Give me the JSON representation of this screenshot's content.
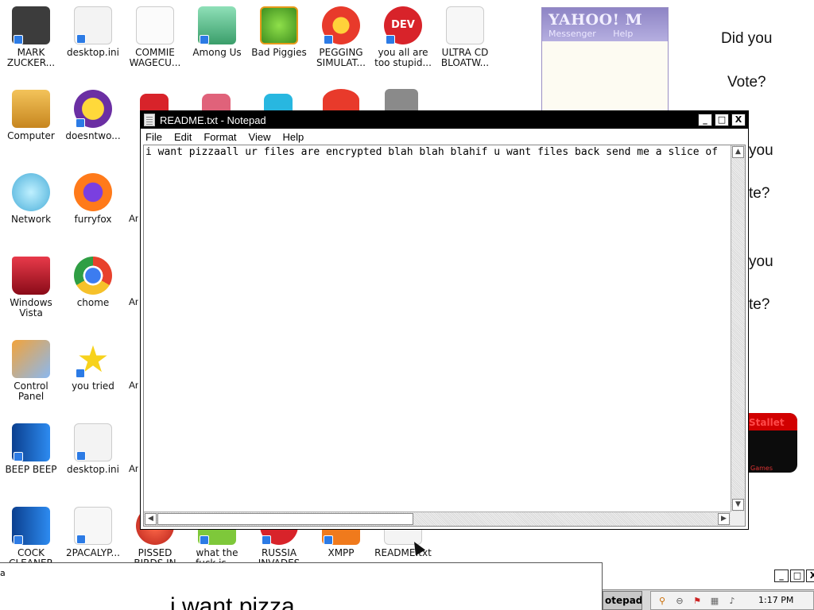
{
  "desktop": {
    "icons": [
      {
        "label": "MARK ZUCKER...",
        "icon": "mark-zuckerberg-icon",
        "color": "#4a4a4a"
      },
      {
        "label": "desktop.ini",
        "icon": "settings-file-icon",
        "color": "#f2f2f2"
      },
      {
        "label": "COMMIE WAGECU...",
        "icon": "document-icon",
        "color": "#fafafa"
      },
      {
        "label": "Among Us",
        "icon": "among-us-icon",
        "color": "#5fbf8a"
      },
      {
        "label": "Bad Piggies",
        "icon": "bad-piggies-icon",
        "color": "#7fcf3a"
      },
      {
        "label": "PEGGING SIMULAT...",
        "icon": "p-logo-icon",
        "color": "#e83a2b"
      },
      {
        "label": "you all are too stupid...",
        "icon": "dev-cpp-icon",
        "color": "#d8232a"
      },
      {
        "label": "ULTRA CD BLOATW...",
        "icon": "document-icon",
        "color": "#f7f7f7"
      },
      {
        "label": "Computer",
        "icon": "computer-icon",
        "color": "#d9a73a"
      },
      {
        "label": "doesntwo...",
        "icon": "yahoo-messenger-icon",
        "color": "#6b2fa3"
      },
      {
        "label": "Network",
        "icon": "network-globe-icon",
        "color": "#5bb7e0"
      },
      {
        "label": "furryfox",
        "icon": "firefox-icon",
        "color": "#ff7a1a"
      },
      {
        "label": "Windows Vista",
        "icon": "recycle-bin-icon",
        "color": "#c4152a"
      },
      {
        "label": "chome",
        "icon": "chrome-icon",
        "color": "#2f9e44"
      },
      {
        "label": "Control Panel",
        "icon": "control-panel-icon",
        "color": "#e08a3a"
      },
      {
        "label": "you tried",
        "icon": "star-icon",
        "color": "#f7d21c"
      },
      {
        "label": "BEEP BEEP",
        "icon": "blue-book-icon",
        "color": "#1f6fc9"
      },
      {
        "label": "desktop.ini",
        "icon": "settings-file-icon",
        "color": "#f2f2f2"
      },
      {
        "label": "COCK CLEANER",
        "icon": "blue-book-icon",
        "color": "#1f6fc9"
      },
      {
        "label": "2PACALYP...",
        "icon": "document-icon",
        "color": "#f7f7f7"
      },
      {
        "label": "PISSED BIRDS IN",
        "icon": "angry-birds-icon",
        "color": "#e0402a"
      },
      {
        "label": "what the fuck is ...",
        "icon": "price-tag-icon",
        "color": "#7ec83a"
      },
      {
        "label": "RUSSIA INVADES",
        "icon": "russia-icon",
        "color": "#d8232a"
      },
      {
        "label": "XMPP",
        "icon": "xmpp-icon",
        "color": "#f07a1c"
      },
      {
        "label": "README.txt",
        "icon": "text-file-icon",
        "color": "#f2f2f2"
      }
    ],
    "partial_labels": [
      "Ar",
      "Ar",
      "Ar",
      "Ar S",
      "Ar S"
    ]
  },
  "yahoo": {
    "brand": "YAHOO! M",
    "menu": [
      "Messenger",
      "Help"
    ]
  },
  "side_text": [
    "Did you",
    "Vote?",
    "you",
    "te?",
    "you",
    "te?"
  ],
  "red_box": {
    "title": "Stallet",
    "sub": "Games"
  },
  "notepad": {
    "title": "README.txt - Notepad",
    "menu": [
      "File",
      "Edit",
      "Format",
      "View",
      "Help"
    ],
    "content": "i want pizzaall ur files are encrypted blah blah blahif u want files back send me a slice of",
    "controls": {
      "minimize": "_",
      "maximize": "□",
      "close": "X"
    }
  },
  "bottom_window": {
    "tiny": "a",
    "heading": "i want pizza"
  },
  "taskbar": {
    "task_label": "otepad",
    "clock": "1:17 PM"
  }
}
